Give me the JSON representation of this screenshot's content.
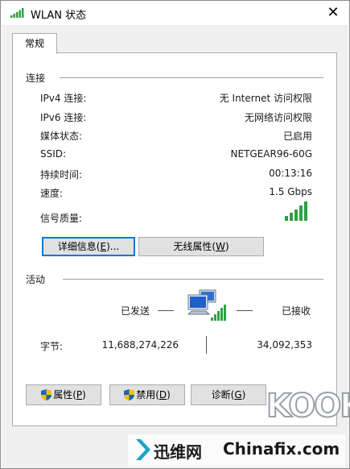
{
  "window": {
    "title": "WLAN 状态",
    "close_glyph": "✕"
  },
  "tabs": [
    {
      "label": "常规"
    }
  ],
  "connection": {
    "heading": "连接",
    "rows": [
      {
        "label": "IPv4 连接:",
        "value": "无 Internet 访问权限"
      },
      {
        "label": "IPv6 连接:",
        "value": "无网络访问权限"
      },
      {
        "label": "媒体状态:",
        "value": "已启用"
      },
      {
        "label": "SSID:",
        "value": "NETGEAR96-60G"
      },
      {
        "label": "持续时间:",
        "value": "00:13:16"
      },
      {
        "label": "速度:",
        "value": "1.5 Gbps"
      }
    ],
    "signal_label": "信号质量:",
    "signal_bars": 5,
    "signal_color": "#2ea043",
    "details_button": {
      "text": "详细信息(",
      "accel": "E",
      "suffix": ")..."
    },
    "wireless_button": {
      "text": "无线属性(",
      "accel": "W",
      "suffix": ")"
    }
  },
  "activity": {
    "heading": "活动",
    "sent_label": "已发送",
    "received_label": "已接收",
    "bytes_label": "字节:",
    "bytes_sent": "11,688,274,226",
    "bytes_received": "34,092,353"
  },
  "bottom_buttons": {
    "properties": {
      "text": "属性(",
      "accel": "P",
      "suffix": ")"
    },
    "disable": {
      "text": "禁用(",
      "accel": "D",
      "suffix": ")"
    },
    "diagnose": {
      "text": "诊断(",
      "accel": "G",
      "suffix": ")"
    }
  },
  "watermark": {
    "logo_text": "KOOK",
    "brand_cn": "迅维网",
    "brand_en": "Chinafix.com"
  },
  "colors": {
    "accent": "#0078d7",
    "button_face": "#e1e1e1"
  }
}
